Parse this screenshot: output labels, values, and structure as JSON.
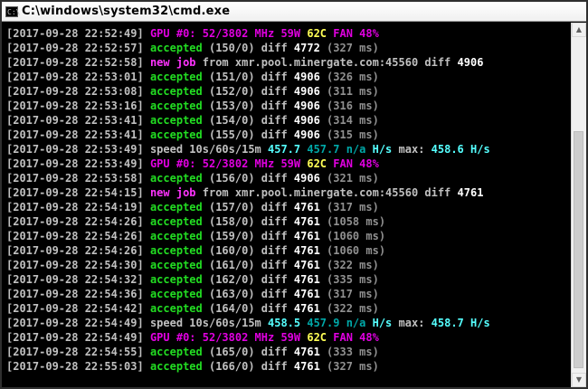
{
  "window": {
    "title": "C:\\windows\\system32\\cmd.exe",
    "icon_label": "C:\\"
  },
  "lines": [
    [
      {
        "t": "[2017-09-28 22:52:49] ",
        "c": "ts"
      },
      {
        "t": "GPU #0: 52/3802 MHz 59W ",
        "c": "gpu"
      },
      {
        "t": "62C ",
        "c": "yel"
      },
      {
        "t": "FAN 48%",
        "c": "gpu"
      }
    ],
    [
      {
        "t": "[2017-09-28 22:52:57] ",
        "c": "ts"
      },
      {
        "t": "accepted ",
        "c": "grn"
      },
      {
        "t": "(150/0) diff ",
        "c": "ts"
      },
      {
        "t": "4772 ",
        "c": "wht"
      },
      {
        "t": "(327 ms)",
        "c": "gry"
      }
    ],
    [
      {
        "t": "[2017-09-28 22:52:58] ",
        "c": "ts"
      },
      {
        "t": "new job ",
        "c": "mag"
      },
      {
        "t": "from xmr.pool.minergate.com:45560 diff ",
        "c": "ts"
      },
      {
        "t": "4906",
        "c": "wht"
      }
    ],
    [
      {
        "t": "[2017-09-28 22:53:01] ",
        "c": "ts"
      },
      {
        "t": "accepted ",
        "c": "grn"
      },
      {
        "t": "(151/0) diff ",
        "c": "ts"
      },
      {
        "t": "4906 ",
        "c": "wht"
      },
      {
        "t": "(326 ms)",
        "c": "gry"
      }
    ],
    [
      {
        "t": "[2017-09-28 22:53:08] ",
        "c": "ts"
      },
      {
        "t": "accepted ",
        "c": "grn"
      },
      {
        "t": "(152/0) diff ",
        "c": "ts"
      },
      {
        "t": "4906 ",
        "c": "wht"
      },
      {
        "t": "(311 ms)",
        "c": "gry"
      }
    ],
    [
      {
        "t": "[2017-09-28 22:53:16] ",
        "c": "ts"
      },
      {
        "t": "accepted ",
        "c": "grn"
      },
      {
        "t": "(153/0) diff ",
        "c": "ts"
      },
      {
        "t": "4906 ",
        "c": "wht"
      },
      {
        "t": "(316 ms)",
        "c": "gry"
      }
    ],
    [
      {
        "t": "[2017-09-28 22:53:41] ",
        "c": "ts"
      },
      {
        "t": "accepted ",
        "c": "grn"
      },
      {
        "t": "(154/0) diff ",
        "c": "ts"
      },
      {
        "t": "4906 ",
        "c": "wht"
      },
      {
        "t": "(314 ms)",
        "c": "gry"
      }
    ],
    [
      {
        "t": "[2017-09-28 22:53:41] ",
        "c": "ts"
      },
      {
        "t": "accepted ",
        "c": "grn"
      },
      {
        "t": "(155/0) diff ",
        "c": "ts"
      },
      {
        "t": "4906 ",
        "c": "wht"
      },
      {
        "t": "(315 ms)",
        "c": "gry"
      }
    ],
    [
      {
        "t": "[2017-09-28 22:53:49] ",
        "c": "ts"
      },
      {
        "t": "speed 10s/60s/15m ",
        "c": "ts"
      },
      {
        "t": "457.7 ",
        "c": "cyn"
      },
      {
        "t": "457.7 n/a ",
        "c": "dcy"
      },
      {
        "t": "H/s ",
        "c": "cyn"
      },
      {
        "t": "max: ",
        "c": "ts"
      },
      {
        "t": "458.6 H/s",
        "c": "cyn"
      }
    ],
    [
      {
        "t": "[2017-09-28 22:53:49] ",
        "c": "ts"
      },
      {
        "t": "GPU #0: 52/3802 MHz 59W ",
        "c": "gpu"
      },
      {
        "t": "62C ",
        "c": "yel"
      },
      {
        "t": "FAN 48%",
        "c": "gpu"
      }
    ],
    [
      {
        "t": "[2017-09-28 22:53:58] ",
        "c": "ts"
      },
      {
        "t": "accepted ",
        "c": "grn"
      },
      {
        "t": "(156/0) diff ",
        "c": "ts"
      },
      {
        "t": "4906 ",
        "c": "wht"
      },
      {
        "t": "(321 ms)",
        "c": "gry"
      }
    ],
    [
      {
        "t": "[2017-09-28 22:54:15] ",
        "c": "ts"
      },
      {
        "t": "new job ",
        "c": "mag"
      },
      {
        "t": "from xmr.pool.minergate.com:45560 diff ",
        "c": "ts"
      },
      {
        "t": "4761",
        "c": "wht"
      }
    ],
    [
      {
        "t": "[2017-09-28 22:54:19] ",
        "c": "ts"
      },
      {
        "t": "accepted ",
        "c": "grn"
      },
      {
        "t": "(157/0) diff ",
        "c": "ts"
      },
      {
        "t": "4761 ",
        "c": "wht"
      },
      {
        "t": "(317 ms)",
        "c": "gry"
      }
    ],
    [
      {
        "t": "[2017-09-28 22:54:26] ",
        "c": "ts"
      },
      {
        "t": "accepted ",
        "c": "grn"
      },
      {
        "t": "(158/0) diff ",
        "c": "ts"
      },
      {
        "t": "4761 ",
        "c": "wht"
      },
      {
        "t": "(1058 ms)",
        "c": "gry"
      }
    ],
    [
      {
        "t": "[2017-09-28 22:54:26] ",
        "c": "ts"
      },
      {
        "t": "accepted ",
        "c": "grn"
      },
      {
        "t": "(159/0) diff ",
        "c": "ts"
      },
      {
        "t": "4761 ",
        "c": "wht"
      },
      {
        "t": "(1060 ms)",
        "c": "gry"
      }
    ],
    [
      {
        "t": "[2017-09-28 22:54:26] ",
        "c": "ts"
      },
      {
        "t": "accepted ",
        "c": "grn"
      },
      {
        "t": "(160/0) diff ",
        "c": "ts"
      },
      {
        "t": "4761 ",
        "c": "wht"
      },
      {
        "t": "(1060 ms)",
        "c": "gry"
      }
    ],
    [
      {
        "t": "[2017-09-28 22:54:30] ",
        "c": "ts"
      },
      {
        "t": "accepted ",
        "c": "grn"
      },
      {
        "t": "(161/0) diff ",
        "c": "ts"
      },
      {
        "t": "4761 ",
        "c": "wht"
      },
      {
        "t": "(322 ms)",
        "c": "gry"
      }
    ],
    [
      {
        "t": "[2017-09-28 22:54:32] ",
        "c": "ts"
      },
      {
        "t": "accepted ",
        "c": "grn"
      },
      {
        "t": "(162/0) diff ",
        "c": "ts"
      },
      {
        "t": "4761 ",
        "c": "wht"
      },
      {
        "t": "(335 ms)",
        "c": "gry"
      }
    ],
    [
      {
        "t": "[2017-09-28 22:54:36] ",
        "c": "ts"
      },
      {
        "t": "accepted ",
        "c": "grn"
      },
      {
        "t": "(163/0) diff ",
        "c": "ts"
      },
      {
        "t": "4761 ",
        "c": "wht"
      },
      {
        "t": "(317 ms)",
        "c": "gry"
      }
    ],
    [
      {
        "t": "[2017-09-28 22:54:42] ",
        "c": "ts"
      },
      {
        "t": "accepted ",
        "c": "grn"
      },
      {
        "t": "(164/0) diff ",
        "c": "ts"
      },
      {
        "t": "4761 ",
        "c": "wht"
      },
      {
        "t": "(322 ms)",
        "c": "gry"
      }
    ],
    [
      {
        "t": "[2017-09-28 22:54:49] ",
        "c": "ts"
      },
      {
        "t": "speed 10s/60s/15m ",
        "c": "ts"
      },
      {
        "t": "458.5 ",
        "c": "cyn"
      },
      {
        "t": "457.9 n/a ",
        "c": "dcy"
      },
      {
        "t": "H/s ",
        "c": "cyn"
      },
      {
        "t": "max: ",
        "c": "ts"
      },
      {
        "t": "458.7 H/s",
        "c": "cyn"
      }
    ],
    [
      {
        "t": "[2017-09-28 22:54:49] ",
        "c": "ts"
      },
      {
        "t": "GPU #0: 52/3802 MHz 59W ",
        "c": "gpu"
      },
      {
        "t": "62C ",
        "c": "yel"
      },
      {
        "t": "FAN 48%",
        "c": "gpu"
      }
    ],
    [
      {
        "t": "[2017-09-28 22:54:55] ",
        "c": "ts"
      },
      {
        "t": "accepted ",
        "c": "grn"
      },
      {
        "t": "(165/0) diff ",
        "c": "ts"
      },
      {
        "t": "4761 ",
        "c": "wht"
      },
      {
        "t": "(333 ms)",
        "c": "gry"
      }
    ],
    [
      {
        "t": "[2017-09-28 22:55:03] ",
        "c": "ts"
      },
      {
        "t": "accepted ",
        "c": "grn"
      },
      {
        "t": "(166/0) diff ",
        "c": "ts"
      },
      {
        "t": "4761 ",
        "c": "wht"
      },
      {
        "t": "(327 ms)",
        "c": "gry"
      }
    ]
  ],
  "colors": {
    "ts": "#c0c0c0",
    "gpu": "#e000e0",
    "yel": "#ffff55",
    "grn": "#22dd22",
    "wht": "#ffffff",
    "gry": "#909090",
    "mag": "#ff33ff",
    "cyn": "#55ffff",
    "dcy": "#00a8a8",
    "console_bg": "#000000"
  },
  "icons": {
    "app": "cmd-icon",
    "scroll_up": "arrow-up-icon",
    "scroll_down": "arrow-down-icon"
  }
}
